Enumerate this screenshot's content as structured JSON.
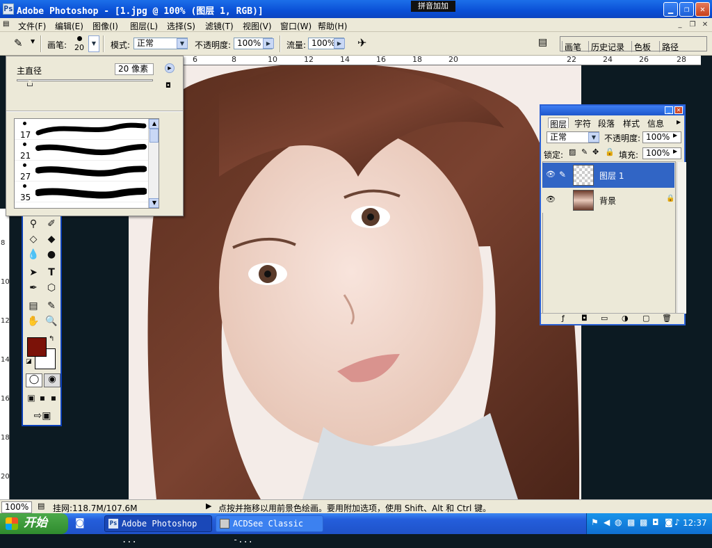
{
  "titlebar": {
    "title": "Adobe Photoshop - [1.jpg @ 100% (图层 1, RGB)]",
    "app_icon": "photoshop-icon",
    "ime_label": "拼音加加"
  },
  "menu": [
    "文件(F)",
    "编辑(E)",
    "图像(I)",
    "图层(L)",
    "选择(S)",
    "滤镜(T)",
    "视图(V)",
    "窗口(W)",
    "帮助(H)"
  ],
  "options": {
    "brush_label": "画笔:",
    "brush_size": "20",
    "mode_label": "模式:",
    "mode_value": "正常",
    "opacity_label": "不透明度:",
    "opacity_value": "100%",
    "flow_label": "流量:",
    "flow_value": "100%"
  },
  "palette_well": {
    "tabs": [
      "画笔",
      "历史记录",
      "色板",
      "路径"
    ]
  },
  "ruler": {
    "h_labels": [
      "6",
      "8",
      "10",
      "12",
      "14",
      "16",
      "18",
      "20",
      "22",
      "24",
      "26",
      "28"
    ],
    "v_labels": [
      "8",
      "10",
      "12",
      "14",
      "16",
      "18",
      "20"
    ]
  },
  "brush_picker": {
    "diameter_label": "主直径",
    "diameter_value": "20 像素",
    "presets": [
      {
        "size": "17"
      },
      {
        "size": "21"
      },
      {
        "size": "27"
      },
      {
        "size": "35"
      }
    ]
  },
  "layers_panel": {
    "tabs": [
      "图层",
      "字符",
      "段落",
      "样式",
      "信息"
    ],
    "blend_mode": "正常",
    "opacity_label": "不透明度:",
    "opacity_value": "100%",
    "lock_label": "锁定:",
    "fill_label": "填充:",
    "fill_value": "100%",
    "layers": [
      {
        "name": "图层 1",
        "selected": true
      },
      {
        "name": "背景",
        "locked": true
      }
    ]
  },
  "status": {
    "zoom": "100%",
    "doc_size": "挂网:118.7M/107.6M",
    "hint": "点按并拖移以用前景色绘画。要用附加选项，使用 Shift、Alt 和 Ctrl 键。"
  },
  "taskbar": {
    "start_label": "开始",
    "tasks": [
      "Adobe Photoshop ...",
      "ACDSee Classic -..."
    ],
    "clock": "12:37"
  },
  "colors": {
    "foreground": "#7b1208",
    "background": "#ffffff",
    "title_blue": "#0a4fd6",
    "layer_selected": "#3165c5"
  }
}
